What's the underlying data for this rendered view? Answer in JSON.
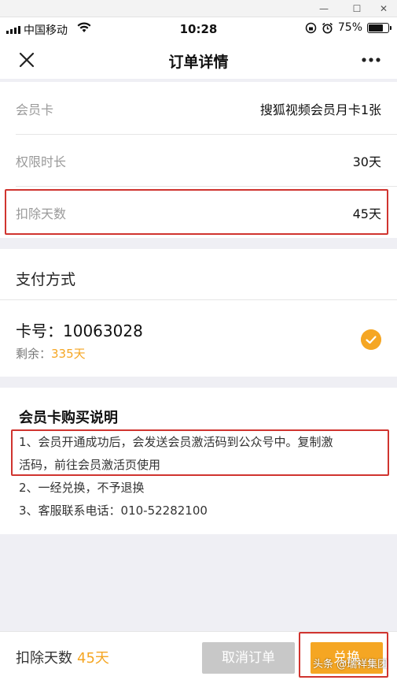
{
  "status_bar": {
    "carrier": "中国移动",
    "time": "10:28",
    "battery_percent": "75%",
    "battery_level": 0.75
  },
  "navbar": {
    "title": "订单详情",
    "close_icon": "close-icon",
    "more_icon": "more-dots-icon"
  },
  "order": {
    "rows": [
      {
        "label": "会员卡",
        "value": "搜狐视频会员月卡1张"
      },
      {
        "label": "权限时长",
        "value": "30天"
      },
      {
        "label": "扣除天数",
        "value": "45天"
      }
    ]
  },
  "payment": {
    "section_title": "支付方式",
    "card_number": "卡号：10063028",
    "remaining_label": "剩余：",
    "remaining_value": "335天",
    "selected": true
  },
  "description": {
    "title": "会员卡购买说明",
    "lines": [
      "1、会员开通成功后，会发送会员激活码到公众号中。复制激",
      "活码，前往会员激活页使用",
      "2、一经兑换，不予退换",
      "3、客服联系电话：010-52282100"
    ]
  },
  "footer": {
    "deduct_label": "扣除天数",
    "deduct_value": "45天",
    "cancel_label": "取消订单",
    "redeem_label": "兑换"
  },
  "watermark": "头条 @瑞祥集团",
  "colors": {
    "accent": "#f5a623",
    "highlight_box": "#d0342f",
    "disabled_button": "#c8c8c8"
  }
}
